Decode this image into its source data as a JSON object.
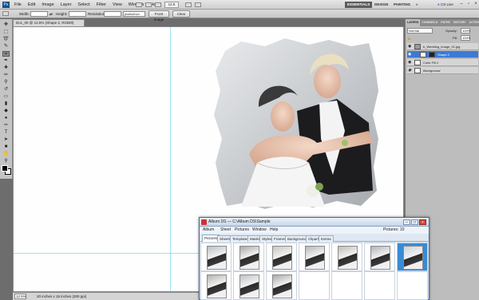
{
  "app": {
    "logo": "Ps"
  },
  "menubar": {
    "items": [
      "File",
      "Edit",
      "Image",
      "Layer",
      "Select",
      "Filter",
      "View",
      "Window",
      "Help"
    ],
    "zoom": "12.5",
    "workspaces": [
      "ESSENTIALS",
      "DESIGN",
      "PAINTING"
    ],
    "cslive": "CS Live"
  },
  "options": {
    "width_label": "Width:",
    "height_label": "Height:",
    "resolution_label": "Resolution:",
    "resolution_unit": "pixels/inch",
    "front_image": "Front Image",
    "clear": "Clear"
  },
  "document": {
    "tab_title": "Doc_00 @ 12.5% (Shape 2, RGB/8)"
  },
  "status": {
    "zoom": "12.5%",
    "info": "20 inches x 15 inches (300 ppi)"
  },
  "layers_panel": {
    "tabs": [
      "LAYERS",
      "CHANNELS",
      "PATHS",
      "HISTORY",
      "ACTIONS"
    ],
    "blend_mode": "Normal",
    "opacity_label": "Opacity:",
    "opacity": "100%",
    "fill_label": "Fill:",
    "fill": "100%",
    "layers": [
      {
        "name": "b_Wedding_image_01.jpg",
        "selected": false
      },
      {
        "name": "Shape 2",
        "selected": true
      },
      {
        "name": "Color Fill 1",
        "selected": false
      },
      {
        "name": "Background",
        "selected": false
      }
    ]
  },
  "album": {
    "title": "Album DS  —  C:\\Album DS\\Sample",
    "menu": [
      "Album",
      "Sheet",
      "Pictures",
      "Window",
      "Help"
    ],
    "pictures_count": "Pictures: 10",
    "tabs": [
      "Pictures",
      "Sheets",
      "Templates",
      "Masks",
      "Styles",
      "Frames",
      "Backgrounds",
      "Clipart",
      "Extras"
    ],
    "active_tab": "Pictures",
    "thumbnails": [
      {
        "selected": false
      },
      {
        "selected": false
      },
      {
        "selected": false
      },
      {
        "selected": false
      },
      {
        "selected": false
      },
      {
        "selected": false
      },
      {
        "selected": true
      },
      {
        "selected": false
      },
      {
        "selected": false
      },
      {
        "selected": false
      }
    ]
  },
  "colors": {
    "selection": "#3b7ad6",
    "guide": "#7fdcf0",
    "album_frame": "#4a6d95"
  }
}
